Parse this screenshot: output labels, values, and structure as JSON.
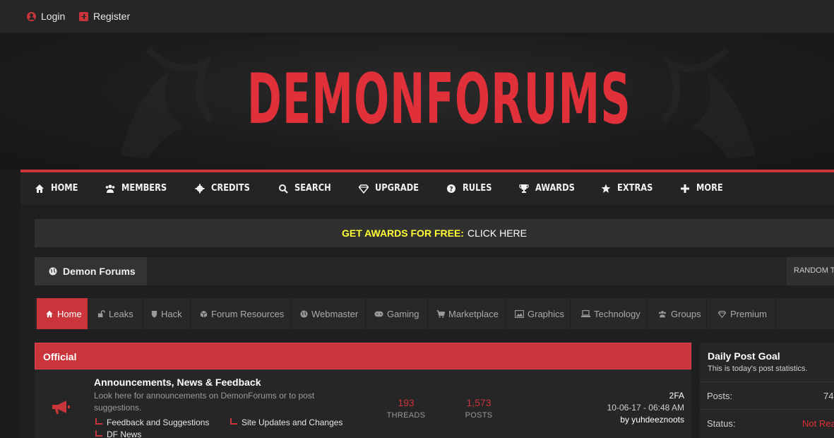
{
  "topbar": {
    "login": "Login",
    "register": "Register"
  },
  "banner": {
    "logo": "DEMONFORUMS"
  },
  "nav": {
    "items": [
      {
        "label": "HOME",
        "icon": "home-icon"
      },
      {
        "label": "MEMBERS",
        "icon": "users-icon"
      },
      {
        "label": "CREDITS",
        "icon": "gear-icon"
      },
      {
        "label": "SEARCH",
        "icon": "search-icon"
      },
      {
        "label": "UPGRADE",
        "icon": "diamond-icon"
      },
      {
        "label": "RULES",
        "icon": "question-icon"
      },
      {
        "label": "AWARDS",
        "icon": "trophy-icon"
      },
      {
        "label": "EXTRAS",
        "icon": "star-icon"
      },
      {
        "label": "MORE",
        "icon": "plus-icon"
      }
    ]
  },
  "promo": {
    "highlight": "GET AWARDS FOR FREE:",
    "link": "CLICK HERE"
  },
  "breadcrumb": {
    "label": "Demon Forums",
    "random": "RANDOM T"
  },
  "subnav": {
    "tabs": [
      {
        "label": "Home",
        "icon": "home-icon"
      },
      {
        "label": "Leaks",
        "icon": "unlock-icon"
      },
      {
        "label": "Hack",
        "icon": "shield-icon"
      },
      {
        "label": "Forum Resources",
        "icon": "cube-icon"
      },
      {
        "label": "Webmaster",
        "icon": "globe-icon"
      },
      {
        "label": "Gaming",
        "icon": "gamepad-icon"
      },
      {
        "label": "Marketplace",
        "icon": "cart-icon"
      },
      {
        "label": "Graphics",
        "icon": "image-icon"
      },
      {
        "label": "Technology",
        "icon": "laptop-icon"
      },
      {
        "label": "Groups",
        "icon": "users-icon"
      },
      {
        "label": "Premium",
        "icon": "diamond-icon"
      }
    ]
  },
  "category": {
    "title": "Official",
    "forum": {
      "title": "Announcements, News & Feedback",
      "description": "Look here for announcements on DemonForums or to post suggestions.",
      "subforums": [
        "Feedback and Suggestions",
        "Site Updates and Changes",
        "DF News"
      ],
      "threads": "193",
      "threads_label": "THREADS",
      "posts": "1,573",
      "posts_label": "POSTS",
      "last_post_title": "2FA",
      "last_post_date": "10-06-17 - 06:48 AM",
      "last_post_by": "by yuhdeeznoots"
    }
  },
  "sidebar_widget": {
    "title": "Daily Post Goal",
    "subtitle": "This is today's post statistics.",
    "posts_label": "Posts:",
    "posts_value": "74",
    "status_label": "Status:",
    "status_value": "Not Rea"
  },
  "colors": {
    "accent": "#c9353a",
    "promo_highlight": "#ffff33"
  }
}
